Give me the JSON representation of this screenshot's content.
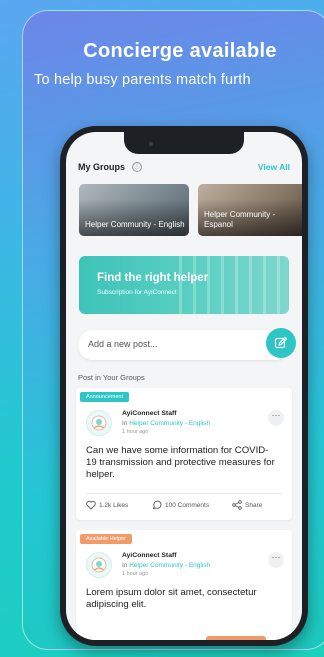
{
  "banner": {
    "headline": "Concierge available",
    "subline": "To help busy parents match furth"
  },
  "app": {
    "my_groups_title": "My Groups",
    "info_icon": "ⓘ",
    "view_all": "View All",
    "groups": [
      {
        "label": "Helper Community - English"
      },
      {
        "label": "Helper Community - Espanol"
      }
    ],
    "promo": {
      "title": "Find the right helper",
      "subtitle": "Subscription for AyiConnect"
    },
    "composer_placeholder": "Add a new post...",
    "section_title": "Post in Your Groups",
    "posts": [
      {
        "tag": "Announcement",
        "author": "AyiConnect Staff",
        "in_prefix": "In",
        "group": "Helper Community - English",
        "time": "1 hour ago",
        "text": "Can we have some information for COVID-19 transmission and protective measures for helper.",
        "likes": "1.2k Likes",
        "comments": "100 Comments",
        "share": "Share"
      },
      {
        "tag": "Available Helper",
        "author": "AyiConnect Staff",
        "in_prefix": "In",
        "group": "Helper Community - English",
        "time": "1 hour ago",
        "text": "Lorem ipsum dolor sit amet, consectetur adipiscing elit."
      }
    ]
  },
  "colors": {
    "accent": "#2ec5c5",
    "tag_orange": "#f29a6a",
    "phone_frame": "#1d2126"
  }
}
